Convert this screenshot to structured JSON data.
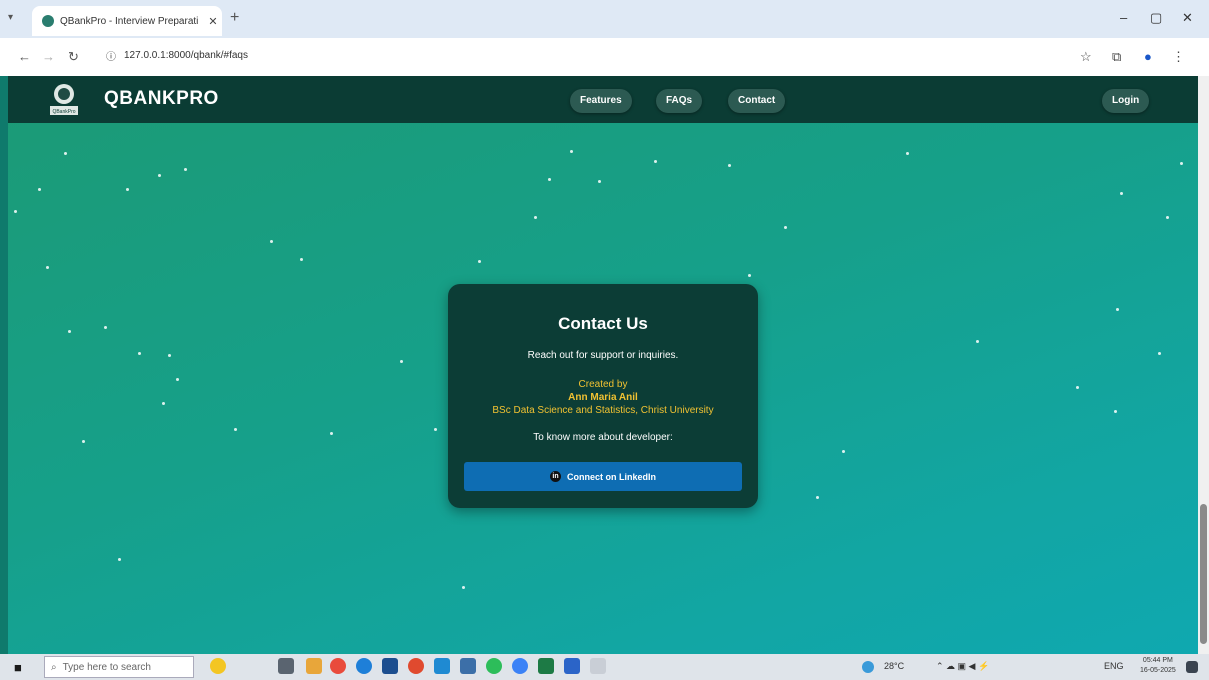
{
  "browser": {
    "tab_title": "QBankPro - Interview Preparati",
    "tab_close": "✕",
    "new_tab": "+",
    "url": "127.0.0.1:8000/qbank/#faqs"
  },
  "header": {
    "brand": "QBANKPRO",
    "logo_text": "QBankPro",
    "nav": [
      {
        "label": "Features"
      },
      {
        "label": "FAQs"
      },
      {
        "label": "Contact"
      }
    ],
    "login_label": "Login"
  },
  "contact": {
    "title": "Contact Us",
    "subtitle": "Reach out for support or inquiries.",
    "created_by": "Created by",
    "author": "Ann Maria Anil",
    "affiliation": "BSc Data Science and Statistics, Christ University",
    "know_more": "To know more about developer:",
    "linkedin_label": "Connect on LinkedIn"
  },
  "taskbar": {
    "search_placeholder": "Type here to search",
    "weather": "28°C",
    "language": "ENG",
    "time": "05:44 PM",
    "date": "16-05-2025"
  },
  "colors": {
    "appbar": "#0b3c34",
    "card": "#0c3d36",
    "gold": "#f1c232",
    "linkedin": "#0e6db3"
  }
}
